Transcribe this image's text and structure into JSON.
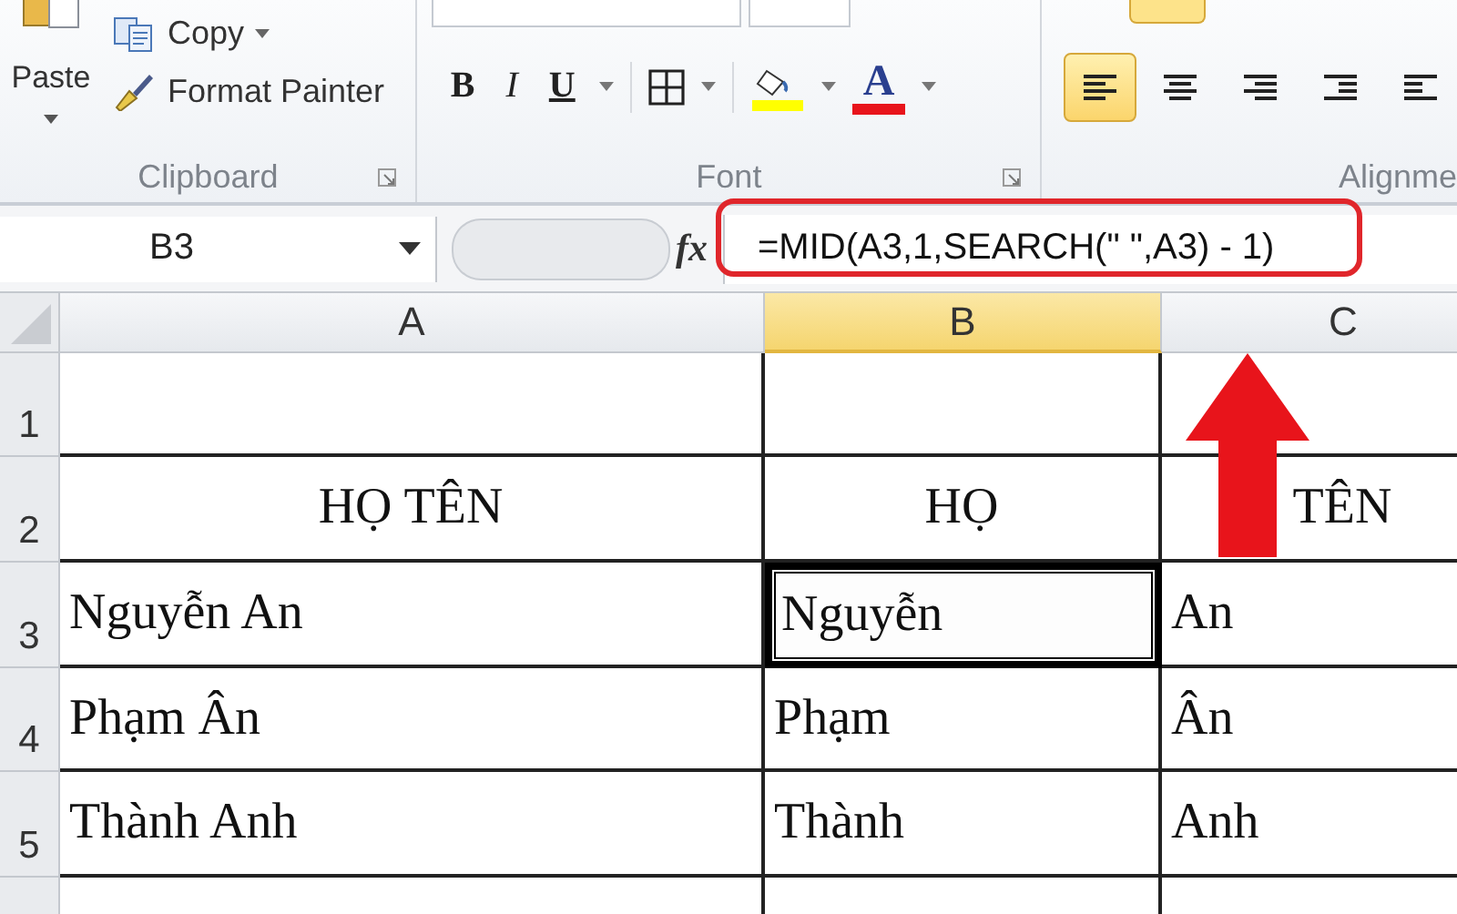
{
  "ribbon": {
    "clipboard": {
      "paste": "Paste",
      "copy": "Copy",
      "format_painter": "Format Painter",
      "label": "Clipboard"
    },
    "font": {
      "bold": "B",
      "italic": "I",
      "underline": "U",
      "font_color": "A",
      "label": "Font"
    },
    "alignment": {
      "label": "Alignme",
      "buttons": [
        {
          "kind": "left",
          "selected": true
        },
        {
          "kind": "center",
          "selected": false
        },
        {
          "kind": "right",
          "selected": false
        },
        {
          "kind": "outdent",
          "selected": false
        },
        {
          "kind": "indent",
          "selected": false
        }
      ]
    }
  },
  "formula_bar": {
    "name_box": "B3",
    "fx": "fx",
    "formula": "=MID(A3,1,SEARCH(\" \",A3) - 1)"
  },
  "sheet": {
    "columns": [
      {
        "label": "A",
        "selected": false
      },
      {
        "label": "B",
        "selected": true
      },
      {
        "label": "C",
        "selected": false
      }
    ],
    "rows": [
      {
        "number": "1",
        "kind": "blank"
      },
      {
        "number": "2",
        "kind": "header",
        "cells": [
          {
            "text": "HỌ TÊN",
            "selected": false
          },
          {
            "text": "HỌ",
            "selected": false
          },
          {
            "text": "TÊN",
            "selected": false
          }
        ]
      },
      {
        "number": "3",
        "kind": "data",
        "cells": [
          {
            "text": "Nguyễn An",
            "selected": false
          },
          {
            "text": "Nguyễn",
            "selected": true
          },
          {
            "text": "An",
            "selected": false
          }
        ]
      },
      {
        "number": "4",
        "kind": "data",
        "cells": [
          {
            "text": "Phạm Ân",
            "selected": false
          },
          {
            "text": "Phạm",
            "selected": false
          },
          {
            "text": "Ân",
            "selected": false
          }
        ]
      },
      {
        "number": "5",
        "kind": "data",
        "cells": [
          {
            "text": "Thành Anh",
            "selected": false
          },
          {
            "text": "Thành",
            "selected": false
          },
          {
            "text": "Anh",
            "selected": false
          }
        ]
      }
    ]
  }
}
